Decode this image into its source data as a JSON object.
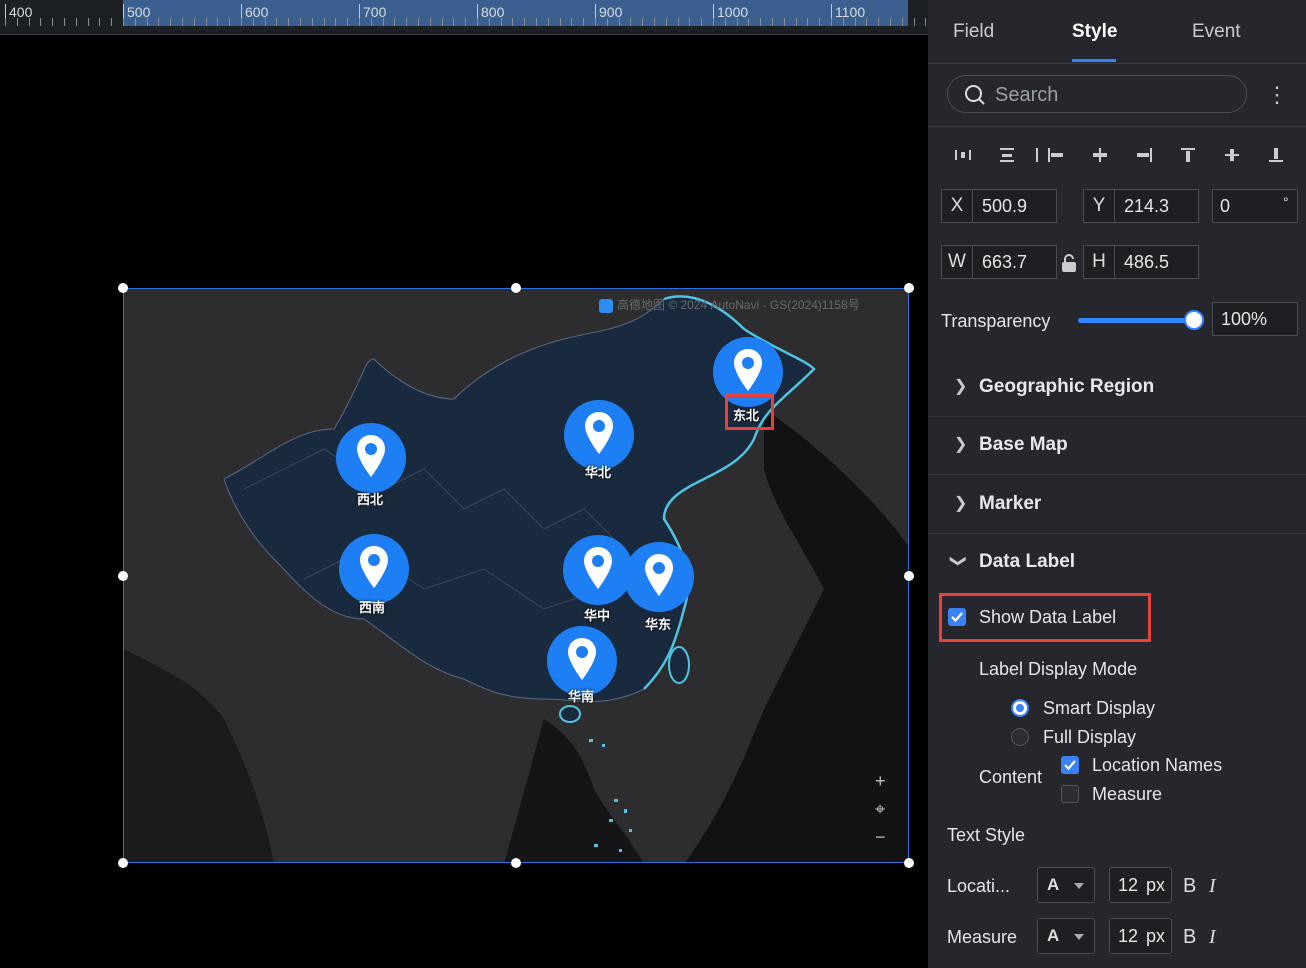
{
  "ruler": {
    "ticks": [
      "400",
      "500",
      "600",
      "700",
      "800",
      "900",
      "1000",
      "1100"
    ]
  },
  "map": {
    "attribution": "高德地图 © 2024 AutoNavi - GS(2024)1158号",
    "markers": [
      {
        "label": "东北"
      },
      {
        "label": "华北"
      },
      {
        "label": "西北"
      },
      {
        "label": "西南"
      },
      {
        "label": "华中"
      },
      {
        "label": "华东"
      },
      {
        "label": "华南"
      }
    ],
    "controls": {
      "zoom_in": "+",
      "locate": "⌖",
      "zoom_out": "−"
    }
  },
  "panel": {
    "tabs": [
      "Field",
      "Style",
      "Event"
    ],
    "active_tab": "Style",
    "search_placeholder": "Search",
    "more": "⋮",
    "x_label": "X",
    "x_value": "500.9",
    "y_label": "Y",
    "y_value": "214.3",
    "rotation_value": "0",
    "rotation_unit": "°",
    "w_label": "W",
    "w_value": "663.7",
    "h_label": "H",
    "h_value": "486.5",
    "transparency_label": "Transparency",
    "transparency_value": "100%",
    "transparency_level": 1.0,
    "sections": [
      "Geographic Region",
      "Base Map",
      "Marker",
      "Data Label"
    ],
    "show_data_label": "Show Data Label",
    "label_display_mode": "Label Display Mode",
    "smart_display": "Smart Display",
    "full_display": "Full Display",
    "content_label": "Content",
    "location_names": "Location Names",
    "measure": "Measure",
    "text_style": "Text Style",
    "location_row": "Locati...",
    "measure_row": "Measure",
    "font_glyph": "A",
    "font_size": "12",
    "font_unit": "px",
    "bold": "B",
    "italic": "I",
    "accent_color": "#2f86ff",
    "highlight_color": "#e8413a"
  }
}
